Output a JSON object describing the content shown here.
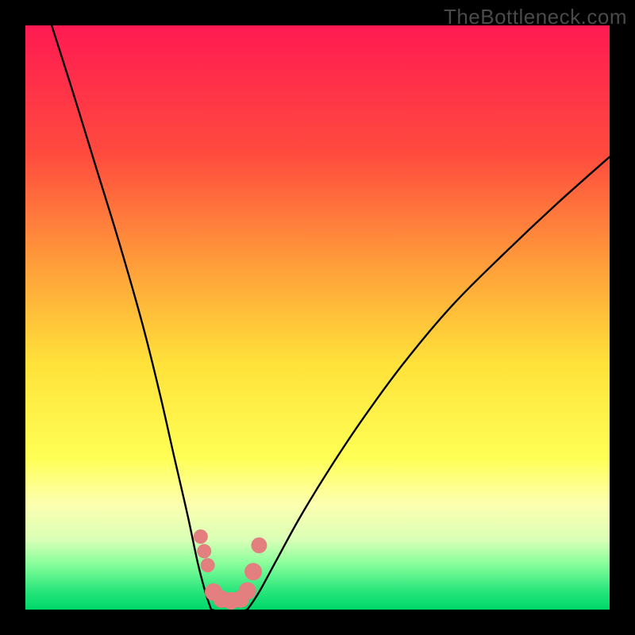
{
  "watermark": "TheBottleneck.com",
  "chart_data": {
    "type": "line",
    "title": "",
    "xlabel": "",
    "ylabel": "",
    "xlim": [
      0,
      100
    ],
    "ylim": [
      0,
      100
    ],
    "gradient_stops": [
      {
        "offset": 0,
        "color": "#ff1a52"
      },
      {
        "offset": 22,
        "color": "#ff4b3e"
      },
      {
        "offset": 42,
        "color": "#ffa23a"
      },
      {
        "offset": 58,
        "color": "#ffe23a"
      },
      {
        "offset": 74,
        "color": "#ffff55"
      },
      {
        "offset": 82,
        "color": "#fdffb0"
      },
      {
        "offset": 88,
        "color": "#daffb6"
      },
      {
        "offset": 92,
        "color": "#8bff9c"
      },
      {
        "offset": 97,
        "color": "#25e57a"
      },
      {
        "offset": 100,
        "color": "#00d86a"
      }
    ],
    "series": [
      {
        "name": "left-branch",
        "x_norm": [
          4.5,
          8,
          12,
          16,
          20,
          23,
          25.5,
          27.8,
          29.5,
          30.8,
          31.8
        ],
        "y_norm": [
          100,
          89,
          76,
          63,
          49,
          37,
          26,
          16,
          8,
          3,
          0
        ]
      },
      {
        "name": "right-branch",
        "x_norm": [
          38,
          40,
          43,
          47,
          52,
          58,
          65,
          73,
          82,
          91,
          100
        ],
        "y_norm": [
          0,
          3,
          8.5,
          15.8,
          24,
          33,
          42.5,
          52,
          61,
          69.5,
          77.5
        ]
      },
      {
        "name": "basin-floor",
        "x_norm": [
          31.8,
          34,
          36,
          38
        ],
        "y_norm": [
          0,
          -0.5,
          -0.5,
          0
        ]
      }
    ],
    "markers": {
      "name": "basin-dots",
      "color": "#e47f7f",
      "points": [
        {
          "x_norm": 30.0,
          "y_norm": 12.5,
          "r": 9
        },
        {
          "x_norm": 30.6,
          "y_norm": 10.0,
          "r": 9
        },
        {
          "x_norm": 31.2,
          "y_norm": 7.6,
          "r": 9
        },
        {
          "x_norm": 32.2,
          "y_norm": 3.0,
          "r": 11
        },
        {
          "x_norm": 33.6,
          "y_norm": 1.8,
          "r": 11
        },
        {
          "x_norm": 35.2,
          "y_norm": 1.5,
          "r": 11
        },
        {
          "x_norm": 36.8,
          "y_norm": 1.8,
          "r": 11
        },
        {
          "x_norm": 38.0,
          "y_norm": 3.2,
          "r": 11
        },
        {
          "x_norm": 39.0,
          "y_norm": 6.5,
          "r": 11
        },
        {
          "x_norm": 40.0,
          "y_norm": 11.0,
          "r": 10
        }
      ]
    }
  }
}
